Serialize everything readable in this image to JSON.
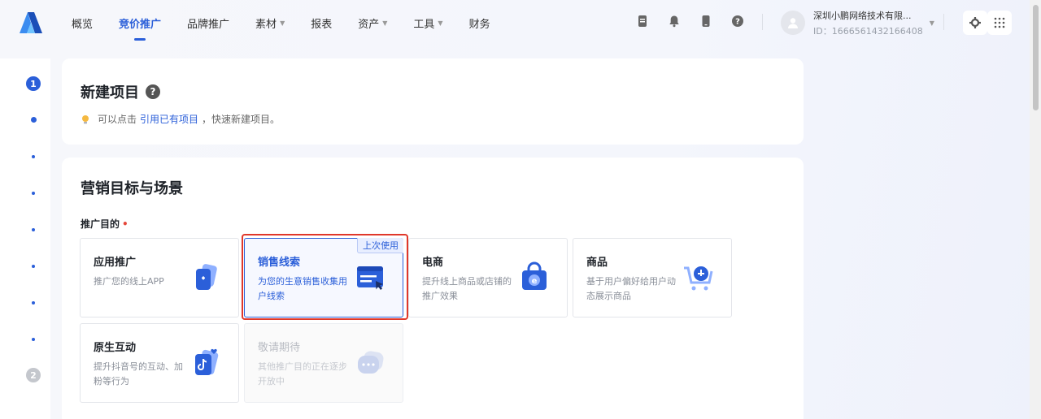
{
  "nav": {
    "items": [
      {
        "label": "概览",
        "active": false,
        "dropdown": false
      },
      {
        "label": "竞价推广",
        "active": true,
        "dropdown": false
      },
      {
        "label": "品牌推广",
        "active": false,
        "dropdown": false
      },
      {
        "label": "素材",
        "active": false,
        "dropdown": true
      },
      {
        "label": "报表",
        "active": false,
        "dropdown": false
      },
      {
        "label": "资产",
        "active": false,
        "dropdown": true
      },
      {
        "label": "工具",
        "active": false,
        "dropdown": true
      },
      {
        "label": "财务",
        "active": false,
        "dropdown": false
      }
    ],
    "icons": [
      "document-icon",
      "bell-icon",
      "phone-icon",
      "help-icon"
    ],
    "account": {
      "name": "深圳小鹏网络技术有限...",
      "id": "ID：1666561432166408"
    }
  },
  "steps": {
    "first": "1",
    "second": "2"
  },
  "project": {
    "title": "新建项目",
    "help": "?",
    "tip_prefix": "可以点击",
    "tip_link": "引用已有项目",
    "tip_suffix": "，快速新建项目。"
  },
  "goals": {
    "title": "营销目标与场景",
    "label": "推广目的",
    "required": "•",
    "options": [
      {
        "title": "应用推广",
        "desc": "推广您的线上APP",
        "icon": "app-icon",
        "state": "normal"
      },
      {
        "title": "销售线索",
        "desc": "为您的生意销售收集用户线索",
        "icon": "form-icon",
        "state": "selected",
        "badge": "上次使用"
      },
      {
        "title": "电商",
        "desc": "提升线上商品或店铺的推广效果",
        "icon": "shop-bag-icon",
        "state": "normal"
      },
      {
        "title": "商品",
        "desc": "基于用户偏好给用户动态展示商品",
        "icon": "cart-icon",
        "state": "normal"
      },
      {
        "title": "原生互动",
        "desc": "提升抖音号的互动、加粉等行为",
        "icon": "douyin-icon",
        "state": "normal"
      },
      {
        "title": "敬请期待",
        "desc": "其他推广目的正在逐步开放中",
        "icon": "chat-icon",
        "state": "disabled"
      }
    ]
  },
  "colors": {
    "accent": "#2b5fd9",
    "highlight": "#e0382b"
  }
}
